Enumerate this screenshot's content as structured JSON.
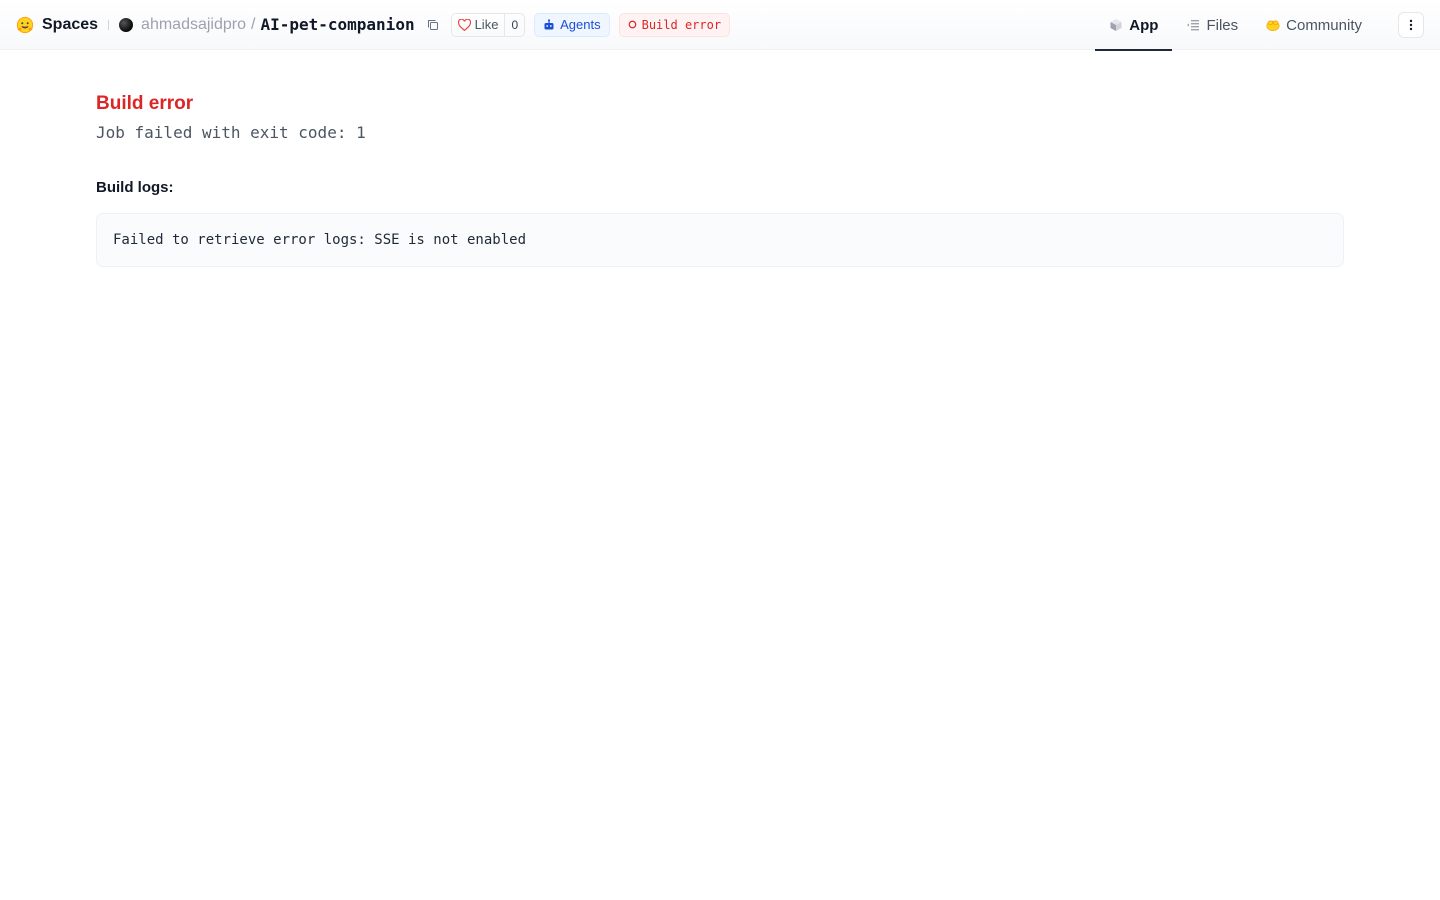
{
  "header": {
    "brand_label": "Spaces",
    "owner": "ahmadsajidpro",
    "separator": "/",
    "repo_name": "AI-pet-companion",
    "like_label": "Like",
    "like_count": "0",
    "agents_label": "Agents",
    "status_label": "Build error"
  },
  "tabs": [
    {
      "label": "App",
      "icon": "cube-icon",
      "active": true
    },
    {
      "label": "Files",
      "icon": "files-icon",
      "active": false
    },
    {
      "label": "Community",
      "icon": "community-icon",
      "active": false
    }
  ],
  "main": {
    "error_title": "Build error",
    "error_detail": "Job failed with exit code: 1",
    "logs_heading": "Build logs:",
    "logs_text": "Failed to retrieve error logs: SSE is not enabled"
  },
  "colors": {
    "error_red": "#dc2626",
    "agents_blue": "#1d4ed8",
    "text_dark": "#111827",
    "muted_gray": "#9ca3af"
  }
}
